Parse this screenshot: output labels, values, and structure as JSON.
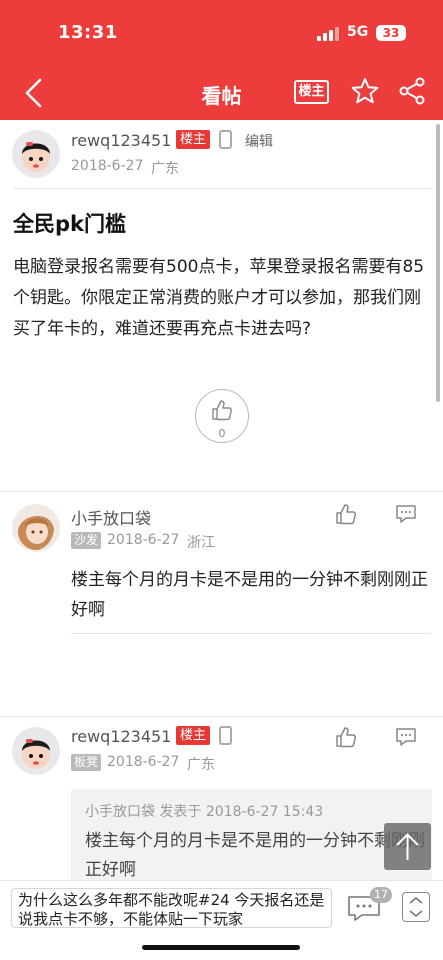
{
  "status_bar": {
    "time": "13:31",
    "network": "5G",
    "battery": "33"
  },
  "nav": {
    "title": "看帖",
    "owner_button": "楼主"
  },
  "post": {
    "author": "rewq123451",
    "owner_badge": "楼主",
    "edit_label": "编辑",
    "date": "2018-6-27",
    "location": "广东",
    "title": "全民pk门槛",
    "body": "电脑登录报名需要有500点卡，苹果登录报名需要有85个钥匙。你限定正常消费的账户才可以参加，那我们刚买了年卡的，难道还要再充点卡进去吗?",
    "like_count": "0"
  },
  "replies": [
    {
      "author": "小手放口袋",
      "floor_badge": "沙发",
      "date": "2018-6-27",
      "location": "浙江",
      "text": "楼主每个月的月卡是不是用的一分钟不剩刚刚正好啊"
    },
    {
      "author": "rewq123451",
      "owner_badge": "楼主",
      "floor_badge": "板凳",
      "date": "2018-6-27",
      "location": "广东",
      "quote_header": "小手放口袋 发表于 2018-6-27 15:43",
      "quote_text": "楼主每个月的月卡是不是用的一分钟不剩刚刚正好啊"
    }
  ],
  "bottom_bar": {
    "input_text": "为什么这么多年都不能改呢#24 今天报名还是说我点卡不够，不能体贴一下玩家",
    "comment_count": "17"
  },
  "colors": {
    "brand_red": "#ec3c3c",
    "badge_red": "#e53935",
    "floor_gray": "#b9b9b9"
  },
  "icons": [
    "back-arrow-icon",
    "star-icon",
    "share-icon",
    "phone-icon",
    "thumbs-up-icon",
    "comment-icon",
    "arrow-up-icon",
    "more-comments-icon",
    "jump-icon"
  ]
}
